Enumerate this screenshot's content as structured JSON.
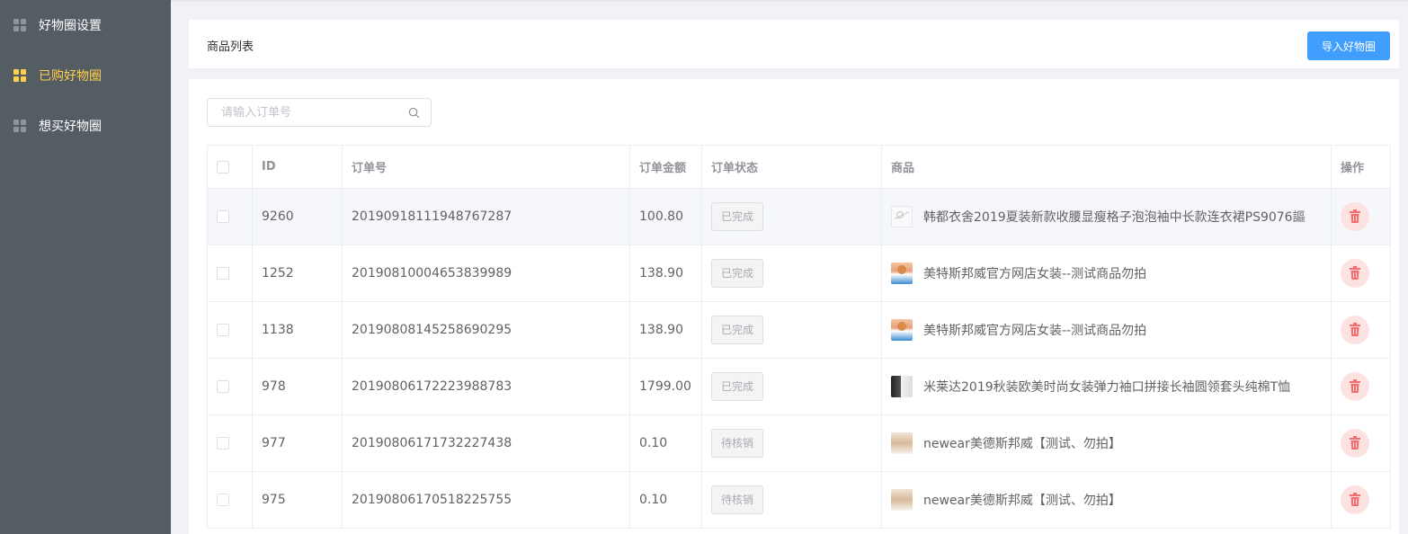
{
  "sidebar": {
    "items": [
      {
        "label": "好物圈设置",
        "icon": "grid-icon",
        "active": false
      },
      {
        "label": "已购好物圈",
        "icon": "grid-icon",
        "active": true
      },
      {
        "label": "想买好物圈",
        "icon": "grid-icon",
        "active": false
      }
    ]
  },
  "header": {
    "title": "商品列表",
    "import_button": "导入好物圈"
  },
  "search": {
    "placeholder": "请输入订单号",
    "value": ""
  },
  "table": {
    "columns": [
      "ID",
      "订单号",
      "订单金额",
      "订单状态",
      "商品",
      "操作"
    ],
    "rows": [
      {
        "id": "9260",
        "order_no": "20190918111948767287",
        "amount": "100.80",
        "status": "已完成",
        "goods": "韩都衣舍2019夏装新款收腰显瘦格子泡泡袖中长款连衣裙PS9076謳",
        "thumb": "placeholder-image"
      },
      {
        "id": "1252",
        "order_no": "20190810004653839989",
        "amount": "138.90",
        "status": "已完成",
        "goods": "美特斯邦威官方网店女装--测试商品勿拍",
        "thumb": "product-image"
      },
      {
        "id": "1138",
        "order_no": "20190808145258690295",
        "amount": "138.90",
        "status": "已完成",
        "goods": "美特斯邦威官方网店女装--测试商品勿拍",
        "thumb": "product-image"
      },
      {
        "id": "978",
        "order_no": "20190806172223988783",
        "amount": "1799.00",
        "status": "已完成",
        "goods": "米莱达2019秋装欧美时尚女装弹力袖口拼接长袖圆领套头纯棉T恤",
        "thumb": "product-image"
      },
      {
        "id": "977",
        "order_no": "20190806171732227438",
        "amount": "0.10",
        "status": "待核销",
        "goods": "newear美德斯邦威【测试、勿拍】",
        "thumb": "product-image"
      },
      {
        "id": "975",
        "order_no": "20190806170518225755",
        "amount": "0.10",
        "status": "待核销",
        "goods": "newear美德斯邦威【测试、勿拍】",
        "thumb": "product-image"
      }
    ]
  },
  "colors": {
    "sidebar_bg": "#545c64",
    "active": "#ffd04b",
    "primary": "#409eff",
    "danger": "#f56c6c"
  }
}
